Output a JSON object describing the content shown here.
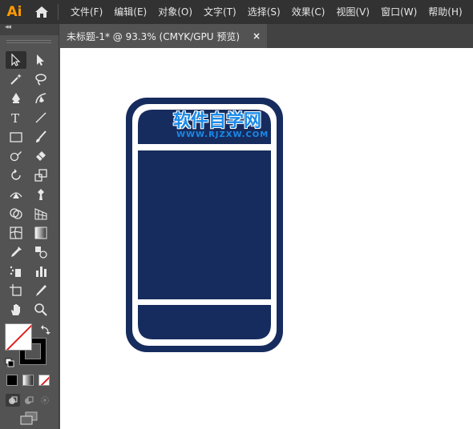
{
  "app": {
    "logo_text": "Ai"
  },
  "menu": {
    "items": [
      "文件(F)",
      "编辑(E)",
      "对象(O)",
      "文字(T)",
      "选择(S)",
      "效果(C)",
      "视图(V)",
      "窗口(W)",
      "帮助(H)"
    ]
  },
  "toolbar": {
    "collapse_glyph": "◂◂"
  },
  "tab": {
    "title": "未标题-1* @ 93.3% (CMYK/GPU 预览)",
    "close_glyph": "×"
  },
  "canvas": {
    "watermark_title": "软件自学网",
    "watermark_url": "WWW.RJZXW.COM",
    "shape_color": "#172c5e"
  },
  "colors": {
    "fill_swatch": "none",
    "stroke_swatch": "#000000"
  }
}
